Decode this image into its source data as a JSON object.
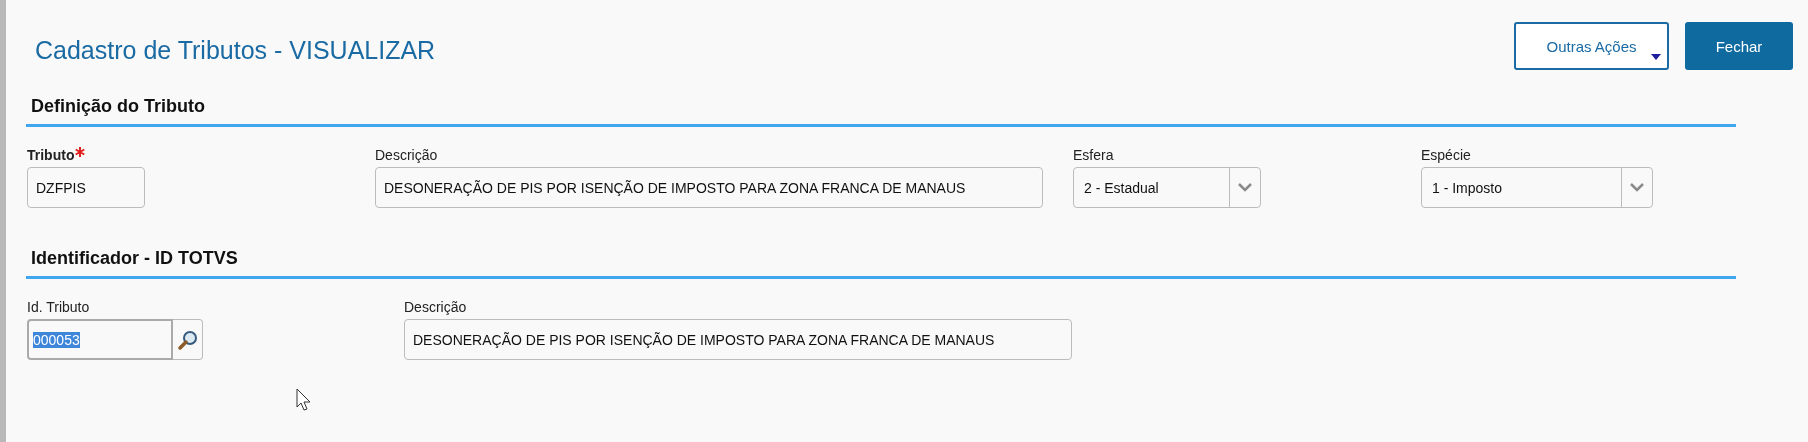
{
  "page": {
    "title": "Cadastro de Tributos - VISUALIZAR"
  },
  "actions": [
    {
      "kind": "dropdown",
      "label": "Outras Ações"
    },
    {
      "kind": "primary",
      "label": "Fechar"
    }
  ],
  "sections": [
    {
      "title": "Definição do Tributo",
      "fields": [
        {
          "kind": "text",
          "label": "Tributo",
          "required": true,
          "value": "DZFPIS"
        },
        {
          "kind": "text",
          "label": "Descrição",
          "required": false,
          "value": "DESONERAÇÃO DE PIS POR ISENÇÃO DE IMPOSTO PARA ZONA FRANCA DE MANAUS"
        },
        {
          "kind": "select",
          "label": "Esfera",
          "required": false,
          "value": "2 - Estadual"
        },
        {
          "kind": "select",
          "label": "Espécie",
          "required": false,
          "value": "1 - Imposto"
        }
      ]
    },
    {
      "title": "Identificador - ID TOTVS",
      "fields": [
        {
          "kind": "lookup",
          "label": "Id. Tributo",
          "required": false,
          "value": "000053",
          "highlighted": true
        },
        {
          "kind": "text",
          "label": "Descrição",
          "required": false,
          "value": "DESONERAÇÃO DE PIS POR ISENÇÃO DE IMPOSTO PARA ZONA FRANCA DE MANAUS"
        }
      ]
    }
  ]
}
